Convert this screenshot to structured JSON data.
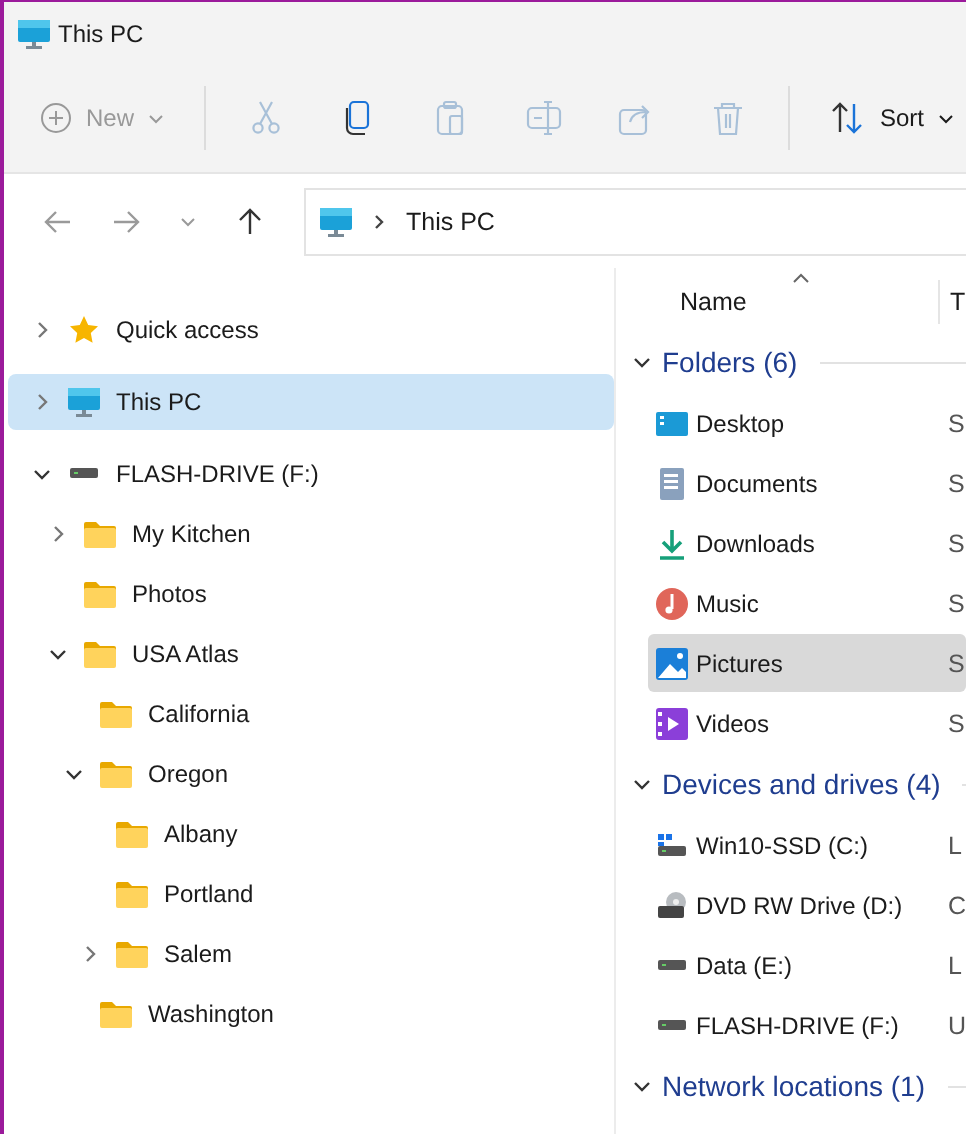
{
  "window": {
    "title": "This PC"
  },
  "toolbar": [
    {
      "kind": "new",
      "label": "New",
      "disabled": true
    },
    {
      "kind": "separator"
    },
    {
      "kind": "cut",
      "disabled": true
    },
    {
      "kind": "copy",
      "disabled": false
    },
    {
      "kind": "paste",
      "disabled": true
    },
    {
      "kind": "rename",
      "disabled": true
    },
    {
      "kind": "share",
      "disabled": true
    },
    {
      "kind": "delete",
      "disabled": true
    },
    {
      "kind": "separator"
    },
    {
      "kind": "sort",
      "label": "Sort",
      "disabled": false
    }
  ],
  "navigation": {
    "back_disabled": true,
    "forward_disabled": true,
    "up_disabled": false
  },
  "address_bar": {
    "path": [
      "This PC"
    ]
  },
  "nav_pane": {
    "items": [
      {
        "label": "Quick access",
        "kind": "star",
        "expanded": false,
        "selected": false
      },
      {
        "label": "This PC",
        "kind": "pc",
        "expanded": false,
        "selected": true
      },
      {
        "label": "FLASH-DRIVE (F:)",
        "kind": "drive",
        "expanded": true,
        "selected": false,
        "children": [
          {
            "label": "My Kitchen",
            "kind": "folder",
            "expanded": false,
            "selected": false
          },
          {
            "label": "Photos",
            "kind": "folder",
            "selected": false
          },
          {
            "label": "USA Atlas",
            "kind": "folder",
            "expanded": true,
            "selected": false,
            "children": [
              {
                "label": "California",
                "kind": "folder",
                "selected": false
              },
              {
                "label": "Oregon",
                "kind": "folder",
                "expanded": true,
                "selected": false,
                "children": [
                  {
                    "label": "Albany",
                    "kind": "folder",
                    "selected": false
                  },
                  {
                    "label": "Portland",
                    "kind": "folder",
                    "selected": false
                  },
                  {
                    "label": "Salem",
                    "kind": "folder",
                    "expanded": false,
                    "selected": false
                  }
                ]
              },
              {
                "label": "Washington",
                "kind": "folder",
                "selected": false
              }
            ]
          }
        ]
      }
    ]
  },
  "content": {
    "columns": [
      "Name",
      "T"
    ],
    "sort_ascending": true,
    "groups": [
      {
        "title": "Folders (6)",
        "expanded": true,
        "items": [
          {
            "name": "Desktop",
            "kind": "desktop",
            "type": "S",
            "selected": false
          },
          {
            "name": "Documents",
            "kind": "documents",
            "type": "S",
            "selected": false
          },
          {
            "name": "Downloads",
            "kind": "downloads",
            "type": "S",
            "selected": false
          },
          {
            "name": "Music",
            "kind": "music",
            "type": "S",
            "selected": false
          },
          {
            "name": "Pictures",
            "kind": "pictures",
            "type": "S",
            "selected": true
          },
          {
            "name": "Videos",
            "kind": "videos",
            "type": "S",
            "selected": false
          }
        ]
      },
      {
        "title": "Devices and drives (4)",
        "expanded": true,
        "items": [
          {
            "name": "Win10-SSD (C:)",
            "kind": "system-drive",
            "type": "L",
            "selected": false
          },
          {
            "name": "DVD RW Drive (D:)",
            "kind": "dvd-drive",
            "type": "C",
            "selected": false
          },
          {
            "name": "Data (E:)",
            "kind": "drive",
            "type": "L",
            "selected": false
          },
          {
            "name": "FLASH-DRIVE (F:)",
            "kind": "drive",
            "type": "U",
            "selected": false
          }
        ]
      },
      {
        "title": "Network locations (1)",
        "expanded": true
      }
    ]
  }
}
